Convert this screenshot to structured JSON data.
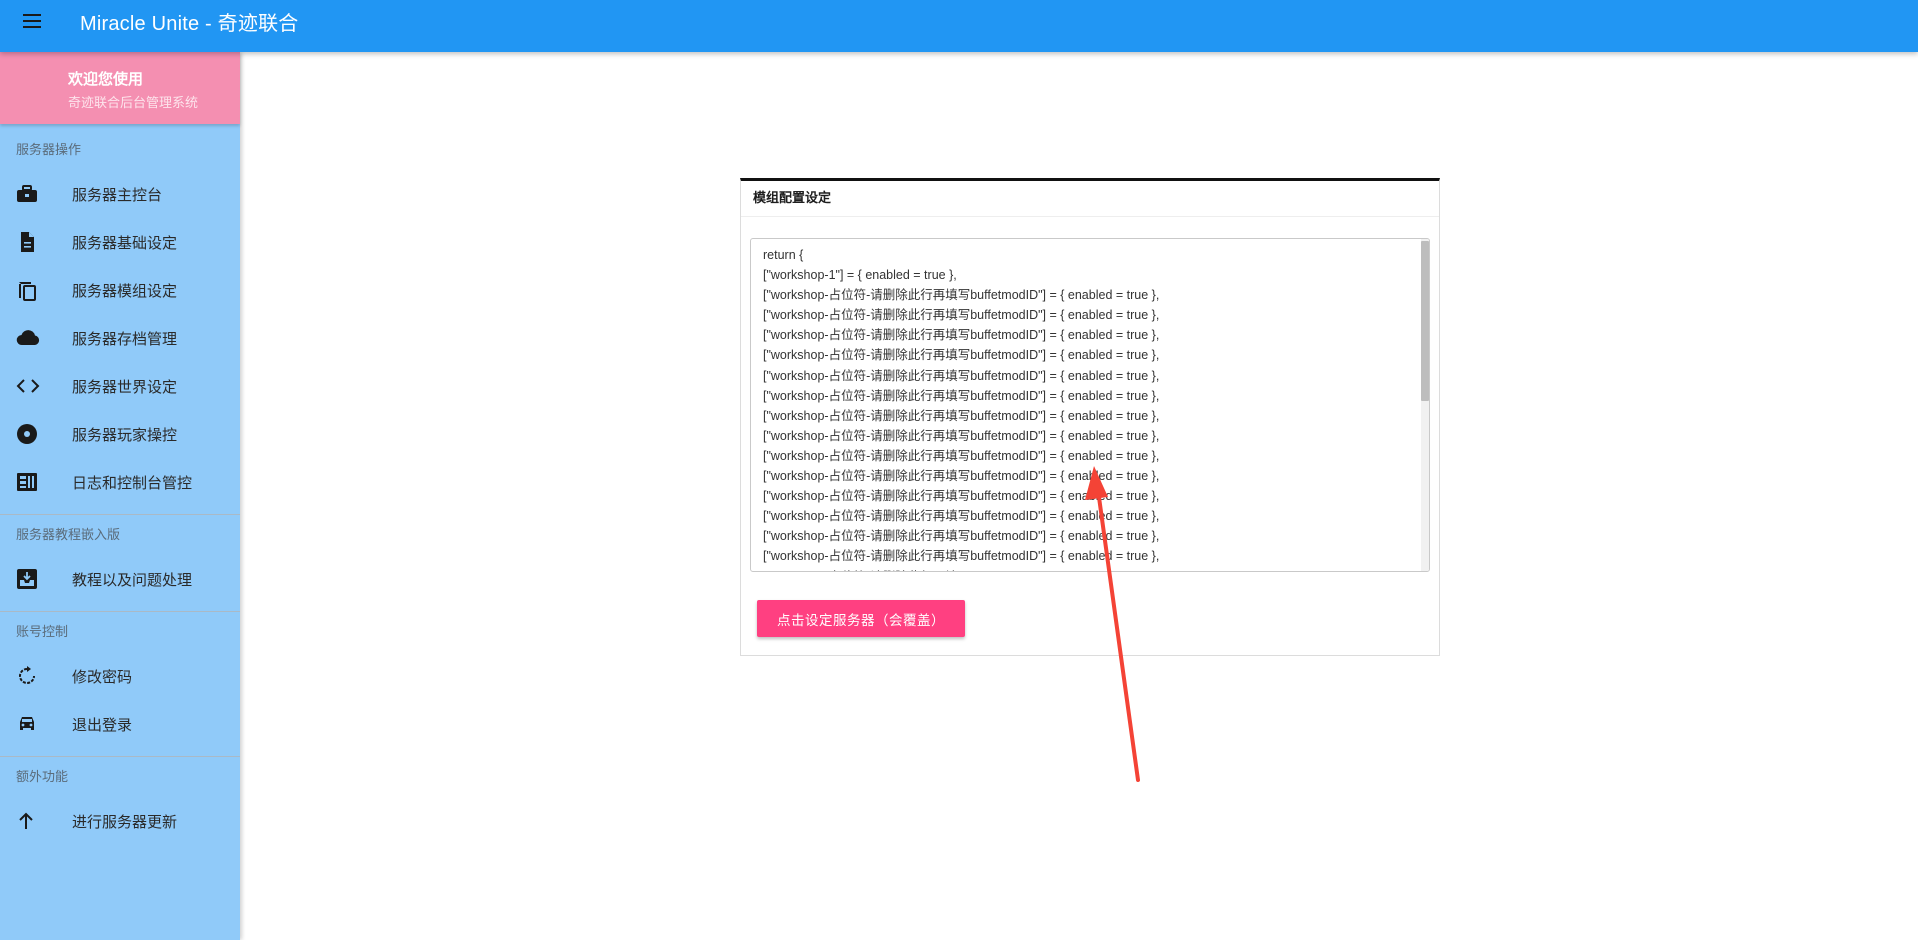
{
  "app": {
    "title": "Miracle Unite - 奇迹联合"
  },
  "welcome": {
    "line1": "欢迎您使用",
    "line2": "奇迹联合后台管理系统"
  },
  "sidebar": {
    "sections": [
      {
        "title": "服务器操作",
        "items": [
          {
            "label": "服务器主控台",
            "icon": "briefcase-icon"
          },
          {
            "label": "服务器基础设定",
            "icon": "document-icon"
          },
          {
            "label": "服务器模组设定",
            "icon": "copy-icon"
          },
          {
            "label": "服务器存档管理",
            "icon": "cloud-icon"
          },
          {
            "label": "服务器世界设定",
            "icon": "code-icon"
          },
          {
            "label": "服务器玩家操控",
            "icon": "disc-icon"
          },
          {
            "label": "日志和控制台管控",
            "icon": "dashboard-icon"
          }
        ]
      },
      {
        "title": "服务器教程嵌入版",
        "items": [
          {
            "label": "教程以及问题处理",
            "icon": "inbox-icon"
          }
        ]
      },
      {
        "title": "账号控制",
        "items": [
          {
            "label": "修改密码",
            "icon": "refresh-icon"
          },
          {
            "label": "退出登录",
            "icon": "car-icon"
          }
        ]
      },
      {
        "title": "额外功能",
        "items": [
          {
            "label": "进行服务器更新",
            "icon": "arrow-up-icon"
          }
        ]
      }
    ]
  },
  "card": {
    "title": "模组配置设定",
    "editor_lines": [
      "return {",
      "[\"workshop-1\"] = { enabled = true },",
      "[\"workshop-占位符-请删除此行再填写buffetmodID\"] = { enabled = true },",
      "[\"workshop-占位符-请删除此行再填写buffetmodID\"] = { enabled = true },",
      "[\"workshop-占位符-请删除此行再填写buffetmodID\"] = { enabled = true },",
      "[\"workshop-占位符-请删除此行再填写buffetmodID\"] = { enabled = true },",
      "[\"workshop-占位符-请删除此行再填写buffetmodID\"] = { enabled = true },",
      "[\"workshop-占位符-请删除此行再填写buffetmodID\"] = { enabled = true },",
      "[\"workshop-占位符-请删除此行再填写buffetmodID\"] = { enabled = true },",
      "[\"workshop-占位符-请删除此行再填写buffetmodID\"] = { enabled = true },",
      "[\"workshop-占位符-请删除此行再填写buffetmodID\"] = { enabled = true },",
      "[\"workshop-占位符-请删除此行再填写buffetmodID\"] = { enabled = true },",
      "[\"workshop-占位符-请删除此行再填写buffetmodID\"] = { enabled = true },",
      "[\"workshop-占位符-请删除此行再填写buffetmodID\"] = { enabled = true },",
      "[\"workshop-占位符-请删除此行再填写buffetmodID\"] = { enabled = true },",
      "[\"workshop-占位符-请删除此行再填写buffetmodID\"] = { enabled = true },",
      "[\"workshop-占位符-请删除此行再填写buffetmodID\"] = { enabled = true },"
    ],
    "submit_label": "点击设定服务器（会覆盖）"
  },
  "colors": {
    "appbar": "#2196f3",
    "sidebar": "#90caf9",
    "welcome": "#f48fb1",
    "button": "#ff4081",
    "annotation_arrow": "#f44336"
  }
}
